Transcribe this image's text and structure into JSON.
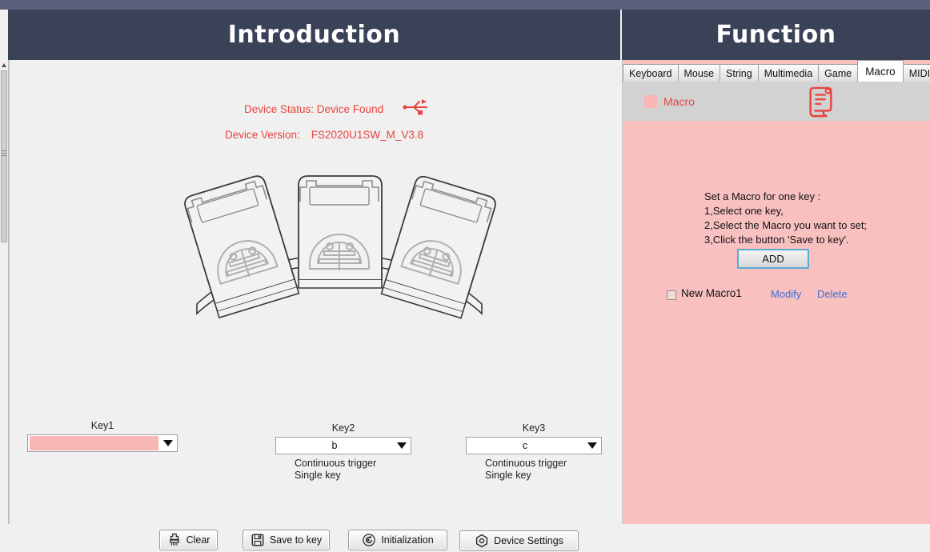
{
  "window": {
    "left_header_title": "Introduction",
    "right_header_title": "Function"
  },
  "introduction": {
    "device_status_label": "Device Status:",
    "device_status_value": "Device Found",
    "device_status_line": "Device Status: Device Found",
    "device_version_label": "Device Version:",
    "device_version_value": "FS2020U1SW_M_V3.8",
    "usb_icon": "usb-icon",
    "device_art": "three-key-foot-pedal-illustration",
    "keys": [
      {
        "label": "Key1",
        "value": "",
        "selected": true,
        "mode_line1": "",
        "mode_line2": ""
      },
      {
        "label": "Key2",
        "value": "b",
        "selected": false,
        "mode_line1": "Continuous trigger",
        "mode_line2": "Single key"
      },
      {
        "label": "Key3",
        "value": "c",
        "selected": false,
        "mode_line1": "Continuous trigger",
        "mode_line2": "Single key"
      }
    ],
    "buttons": [
      {
        "label": "Clear",
        "icon": "brush-icon"
      },
      {
        "label": "Save to key",
        "icon": "floppy-disk-icon"
      },
      {
        "label": "Initialization",
        "icon": "refresh-circle-icon"
      },
      {
        "label": "Device Settings",
        "icon": "hex-gear-icon"
      }
    ]
  },
  "function": {
    "tabs": [
      {
        "label": "Keyboard",
        "active": false
      },
      {
        "label": "Mouse",
        "active": false
      },
      {
        "label": "String",
        "active": false
      },
      {
        "label": "Multimedia",
        "active": false
      },
      {
        "label": "Game",
        "active": false
      },
      {
        "label": "Macro",
        "active": true
      },
      {
        "label": "MIDI",
        "active": false
      }
    ],
    "panel_header_label": "Macro",
    "panel_header_icon": "scroll-document-icon",
    "instructions": "Set a Macro for one key :\n1,Select one key,\n2,Select the Macro you want to set;\n3,Click the button 'Save to key'.",
    "add_button_label": "ADD",
    "macro_list": [
      {
        "name": "New Macro1",
        "checked": false,
        "modify_label": "Modify",
        "delete_label": "Delete"
      }
    ]
  },
  "colors": {
    "header_bg": "#3a4257",
    "top_strip": "#5b617a",
    "panel_bg": "#f0f0f0",
    "accent_red": "#e8433f",
    "pink_panel": "#f9c0c0",
    "pink_highlight": "#f8b6b4",
    "link_blue": "#3f6fd8",
    "add_border_blue": "#5aa9d6"
  }
}
